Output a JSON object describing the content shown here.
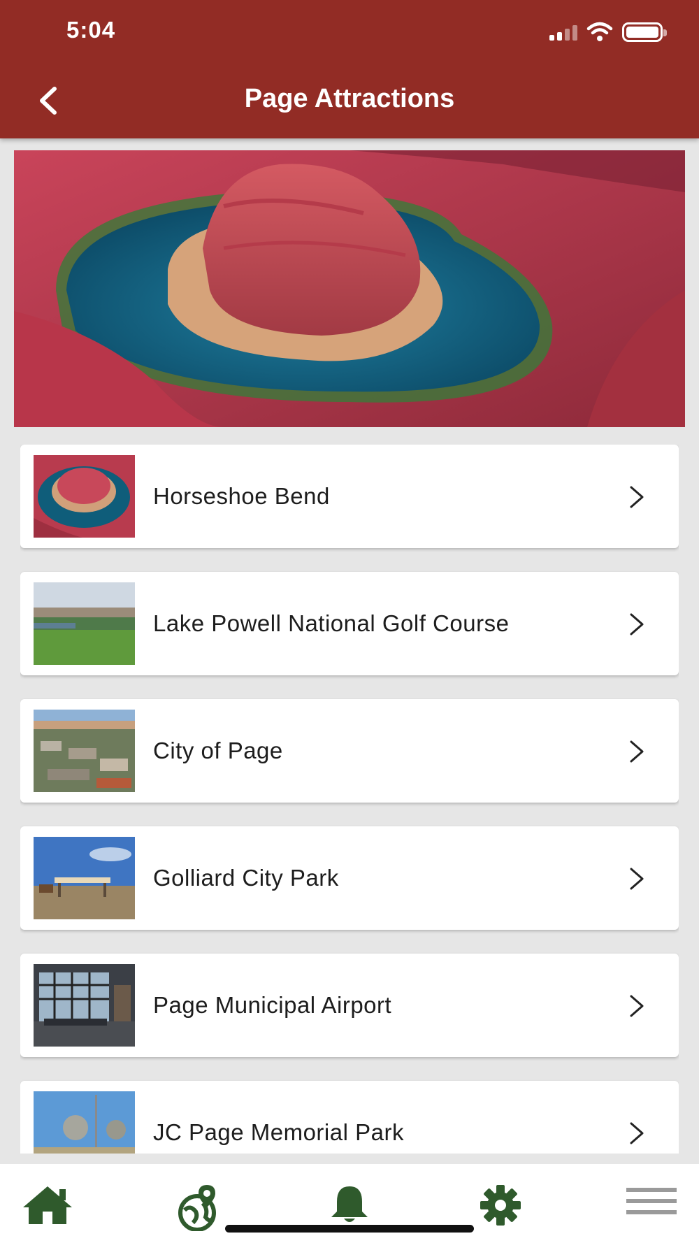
{
  "status_bar": {
    "time": "5:04"
  },
  "header": {
    "title": "Page Attractions"
  },
  "attractions": [
    {
      "label": "Horseshoe Bend"
    },
    {
      "label": "Lake Powell National Golf Course"
    },
    {
      "label": "City of Page"
    },
    {
      "label": "Golliard City Park"
    },
    {
      "label": "Page Municipal Airport"
    },
    {
      "label": "JC Page Memorial Park"
    }
  ],
  "tabbar": {
    "tabs": [
      {
        "icon": "home-icon"
      },
      {
        "icon": "globe-pin-icon"
      },
      {
        "icon": "bell-icon"
      },
      {
        "icon": "gear-icon"
      },
      {
        "icon": "menu-icon"
      }
    ]
  },
  "colors": {
    "header_bg": "#922c25",
    "tab_icon": "#2f5a2c",
    "page_bg": "#e6e6e6"
  }
}
